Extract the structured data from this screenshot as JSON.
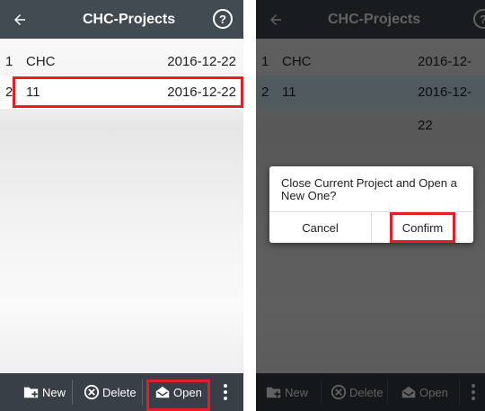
{
  "app": {
    "title": "CHC-Projects",
    "help_glyph": "?"
  },
  "projects": [
    {
      "index": "1",
      "name": "CHC",
      "date": "2016-12-22"
    },
    {
      "index": "2",
      "name": "11",
      "date": "2016-12-22"
    }
  ],
  "footer": {
    "new_label": "New",
    "delete_label": "Delete",
    "open_label": "Open"
  },
  "dialog": {
    "message": "Close Current Project and Open a New One?",
    "cancel_label": "Cancel",
    "confirm_label": "Confirm"
  },
  "colors": {
    "header": "#424a52",
    "footer": "#383f46",
    "selected_row": "#d6ecf7",
    "highlight": "#e41e26"
  },
  "icons": {
    "back": "arrow-left-icon",
    "help": "help-circle-icon",
    "new": "new-project-icon",
    "delete": "delete-circle-icon",
    "open": "open-envelope-icon",
    "more": "more-vert-icon"
  }
}
